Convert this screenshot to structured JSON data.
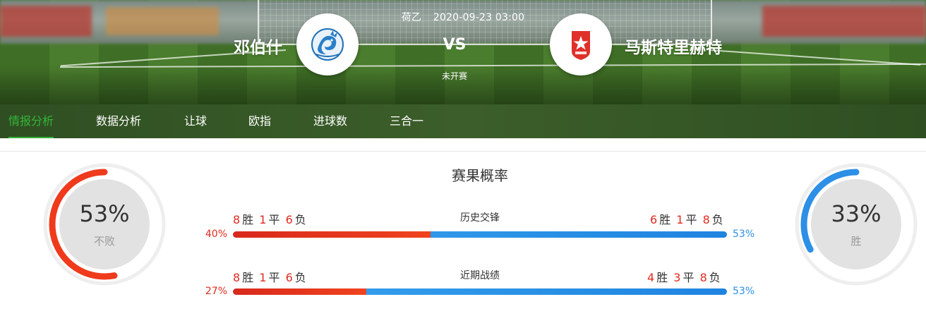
{
  "match": {
    "league": "荷乙",
    "datetime": "2020-09-23 03:00",
    "home_team": "邓伯什",
    "away_team": "马斯特里赫特",
    "vs_label": "VS",
    "status": "未开赛",
    "home_logo_icon": "dragon-crest-icon",
    "away_logo_icon": "mvv-star-shield-icon"
  },
  "tabs": [
    {
      "label": "情报分析",
      "active": true
    },
    {
      "label": "数据分析",
      "active": false
    },
    {
      "label": "让球",
      "active": false
    },
    {
      "label": "欧指",
      "active": false
    },
    {
      "label": "进球数",
      "active": false
    },
    {
      "label": "三合一",
      "active": false
    }
  ],
  "probability": {
    "title": "赛果概率",
    "home_gauge": {
      "value": "53%",
      "caption": "不败",
      "fraction": 0.53,
      "color": "#ef3a1c"
    },
    "away_gauge": {
      "value": "33%",
      "caption": "胜",
      "fraction": 0.33,
      "color": "#2d8fe6"
    },
    "rows": [
      {
        "label": "历史交锋",
        "home": {
          "w": "8",
          "d": "1",
          "l": "6"
        },
        "away": {
          "w": "6",
          "d": "1",
          "l": "8"
        },
        "home_pct": "40%",
        "away_pct": "53%",
        "home_fraction": 0.4
      },
      {
        "label": "近期战绩",
        "home": {
          "w": "8",
          "d": "1",
          "l": "6"
        },
        "away": {
          "w": "4",
          "d": "3",
          "l": "8"
        },
        "home_pct": "27%",
        "away_pct": "53%",
        "home_fraction": 0.27
      }
    ],
    "words": {
      "win": "胜",
      "draw": "平",
      "loss": "负"
    }
  },
  "colors": {
    "accent_green": "#35b53a",
    "red": "#e02b20",
    "blue": "#2d8fe6"
  }
}
